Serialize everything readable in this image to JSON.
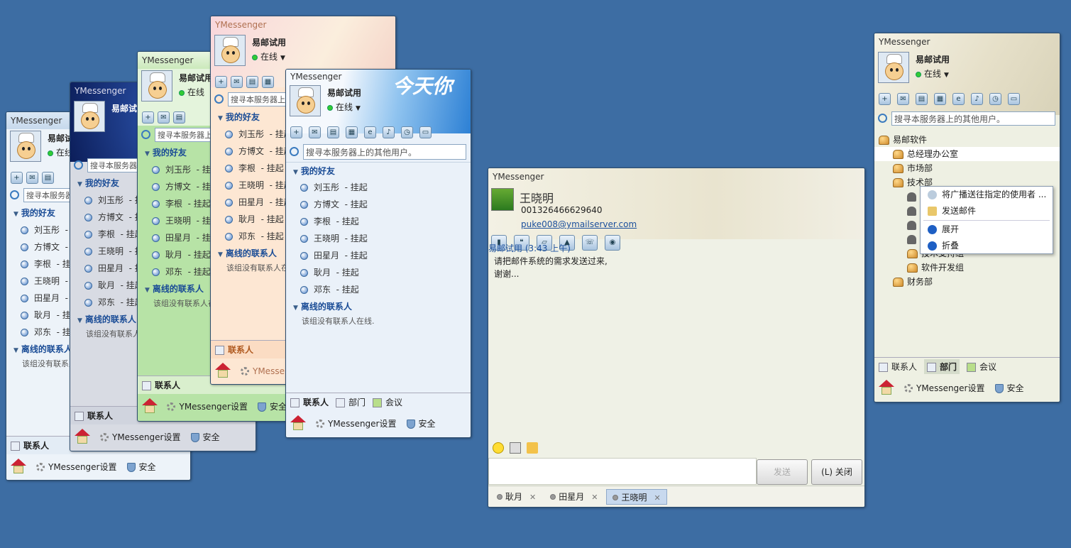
{
  "app_title": "YMessenger",
  "user": {
    "name": "易邮试用",
    "status": "在线"
  },
  "search_placeholder": "搜寻本服务器上的其他用户。",
  "groups": {
    "friends": "我的好友",
    "offline": "离线的联系人",
    "offline_note": "该组没有联系人在线."
  },
  "friends": [
    {
      "name": "刘玉彤",
      "status": "- 挂起"
    },
    {
      "name": "方博文",
      "status": "- 挂起"
    },
    {
      "name": "李根",
      "status": "- 挂起"
    },
    {
      "name": "王晓明",
      "status": "- 挂起"
    },
    {
      "name": "田星月",
      "status": "- 挂起"
    },
    {
      "name": "耿月",
      "status": "- 挂起"
    },
    {
      "name": "邓东",
      "status": "- 挂起"
    }
  ],
  "tabs": {
    "contacts": "联系人",
    "departments": "部门",
    "meetings": "会议"
  },
  "bottom": {
    "settings": "YMessenger设置",
    "security": "安全"
  },
  "banner_text": "今天你",
  "chat": {
    "title": "YMessenger",
    "contact_name": "王晓明",
    "phone": "001326466629640",
    "email": "puke008@ymailserver.com",
    "sender_line": "易邮试用 (3:43 上午)",
    "message_1": "请把邮件系统的需求发送过来,",
    "message_2": "谢谢...",
    "send_label": "发送",
    "close_label": "(L) 关闭",
    "chat_tabs": [
      "耿月",
      "田星月",
      "王晓明"
    ]
  },
  "dept": {
    "root": "易邮软件",
    "items": [
      "总经理办公室",
      "市场部",
      "技术部"
    ],
    "sub": [
      "技术支持组",
      "软件开发组"
    ],
    "finance": "财务部"
  },
  "context_menu": [
    "将广播送往指定的使用者 ...",
    "发送邮件",
    "展开",
    "折叠"
  ],
  "colors": {
    "desktop": "#3d6da3",
    "link": "#1b4f9c"
  }
}
